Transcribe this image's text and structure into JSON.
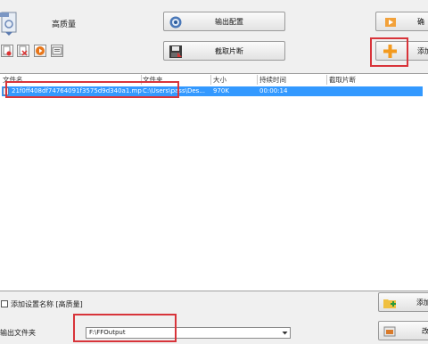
{
  "preset": {
    "quality_label": "高质量"
  },
  "toolbar": {
    "output_settings_label": "输出配置",
    "clip_label": "截取片断",
    "right_top_label": "确",
    "add_file_label": "添加"
  },
  "table": {
    "columns": [
      "文件名",
      "文件夹",
      "大小",
      "持续时间",
      "截取片断"
    ],
    "rows": [
      {
        "name": "21f0ff408df74764091f3575d9d340a1.mp4",
        "folder": "C:\\Users\\pass\\Des...",
        "size": "970K",
        "duration": "00:00:14",
        "clip": ""
      }
    ]
  },
  "bottom": {
    "add_setting_name_label": "添加设置名称 [高质量]",
    "output_folder_label": "输出文件夹",
    "output_folder_value": "F:\\FFOutput",
    "add_button_label": "添加",
    "change_button_label": "改"
  },
  "colors": {
    "selection": "#3399ff",
    "annotation_red": "#d8343a",
    "plus_orange": "#f39a1e"
  }
}
